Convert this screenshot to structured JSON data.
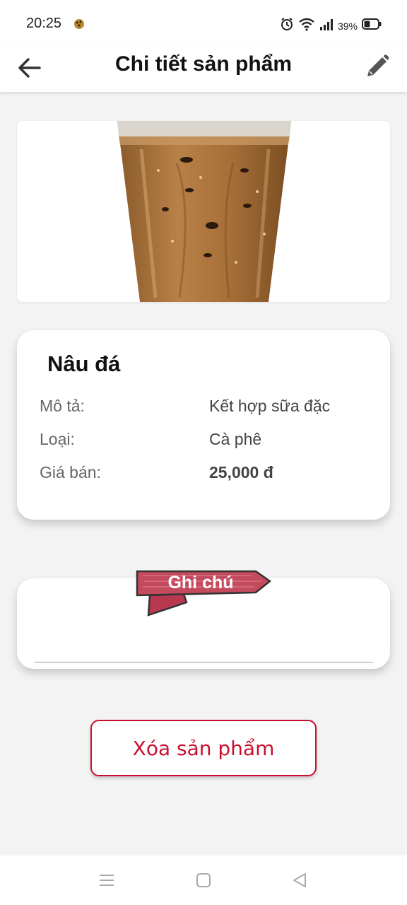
{
  "status_bar": {
    "time": "20:25",
    "battery": "39%",
    "icons": [
      "notification-app-icon",
      "alarm-icon",
      "wifi-icon",
      "signal-icon",
      "battery-icon"
    ]
  },
  "app_bar": {
    "title": "Chi tiết sản phẩm",
    "back_icon": "arrow-left-icon",
    "edit_icon": "pencil-icon"
  },
  "product": {
    "image": "iced-milk-coffee-glass",
    "name": "Nâu đá",
    "fields": [
      {
        "label": "Mô tả:",
        "value": "Kết hợp sữa đặc"
      },
      {
        "label": "Loại:",
        "value": "Cà phê"
      },
      {
        "label": "Giá bán:",
        "value": "25,000 đ"
      }
    ]
  },
  "note": {
    "label": "Ghi chú",
    "value": ""
  },
  "actions": {
    "delete_label": "Xóa sản phẩm"
  },
  "nav_bar": {
    "icons": [
      "menu-icon",
      "home-square-icon",
      "back-triangle-icon"
    ]
  },
  "colors": {
    "accent_red": "#c8102e",
    "ribbon": "#c44a5e",
    "background": "#f3f3f3"
  }
}
